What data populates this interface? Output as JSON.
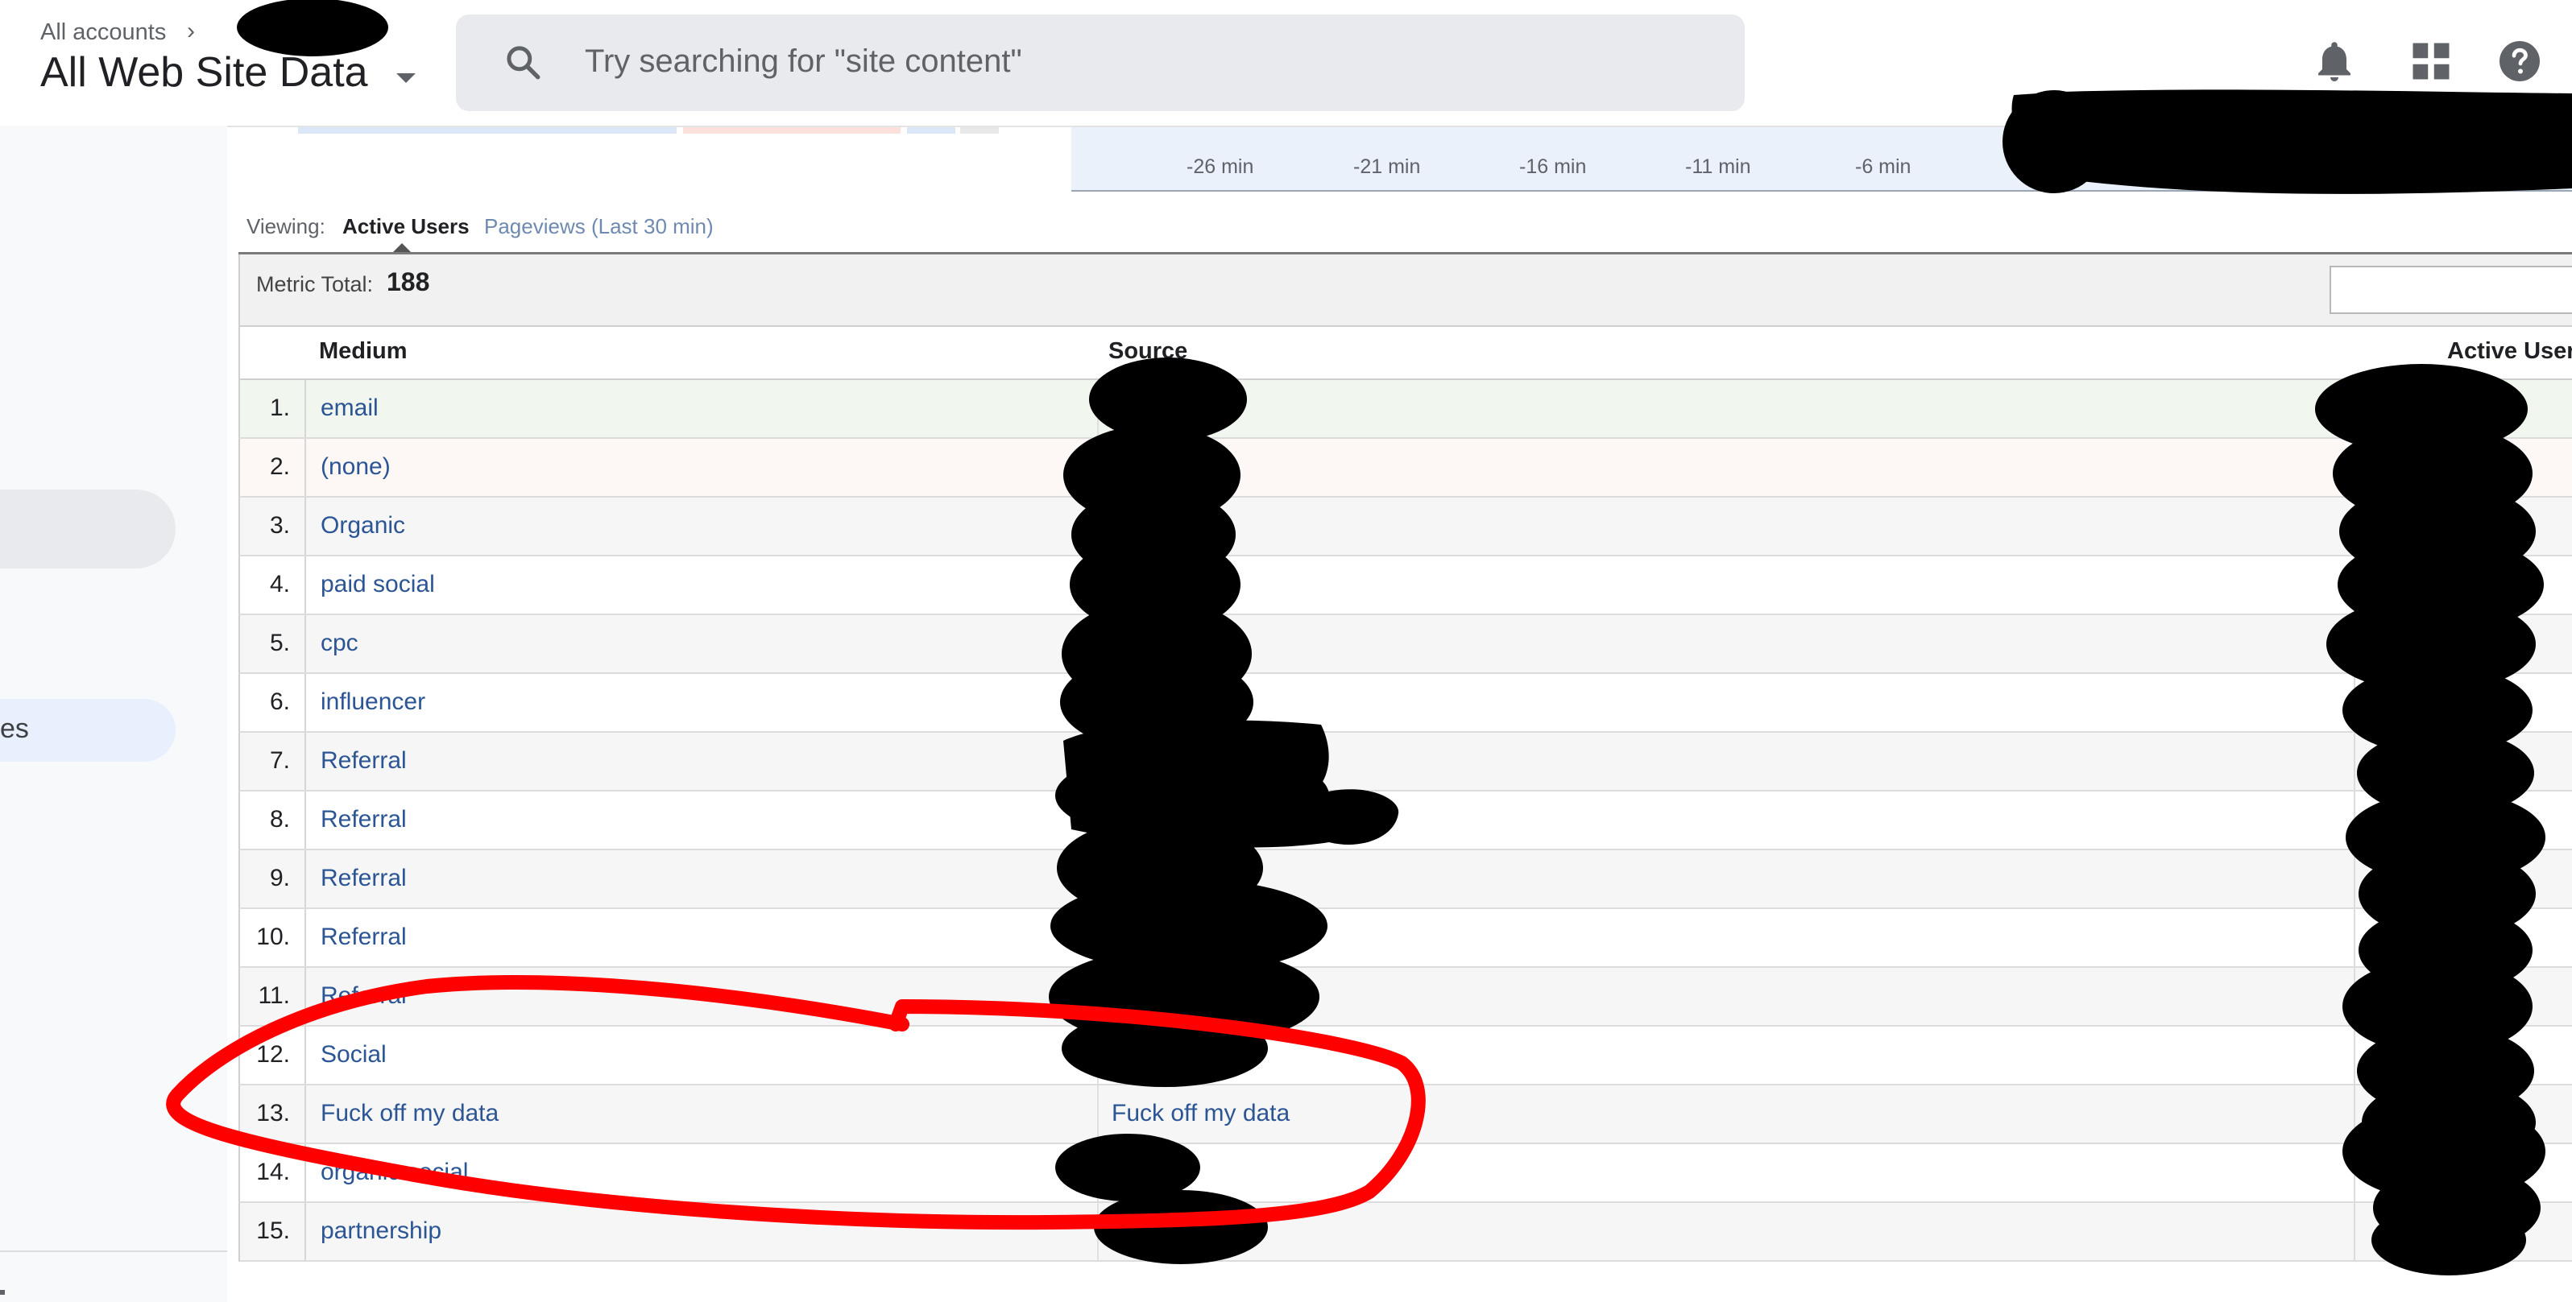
{
  "header": {
    "account_breadcrumb": "All accounts",
    "breadcrumb_chevron": "›",
    "property_name": "All Web Site Data",
    "search_placeholder": "Try searching for \"site content\"",
    "icons": [
      "search-icon",
      "notifications-icon",
      "apps-grid-icon",
      "help-icon"
    ]
  },
  "sidebar": {
    "selected_item_fragment": "es"
  },
  "timeline": {
    "ticks": [
      "-26 min",
      "-21 min",
      "-16 min",
      "-11 min",
      "-6 min"
    ]
  },
  "viewing": {
    "label": "Viewing:",
    "active_tab": "Active Users",
    "other_tab": "Pageviews (Last 30 min)"
  },
  "metric": {
    "label": "Metric Total:",
    "value": "188"
  },
  "table": {
    "columns": [
      "Medium",
      "Source",
      "Active Users"
    ],
    "rows": [
      {
        "index": "1.",
        "medium": "email",
        "source": ""
      },
      {
        "index": "2.",
        "medium": "(none)",
        "source": ""
      },
      {
        "index": "3.",
        "medium": "Organic",
        "source": ""
      },
      {
        "index": "4.",
        "medium": "paid social",
        "source": ""
      },
      {
        "index": "5.",
        "medium": "cpc",
        "source": ""
      },
      {
        "index": "6.",
        "medium": "influencer",
        "source": ""
      },
      {
        "index": "7.",
        "medium": "Referral",
        "source": ""
      },
      {
        "index": "8.",
        "medium": "Referral",
        "source": ""
      },
      {
        "index": "9.",
        "medium": "Referral",
        "source": ""
      },
      {
        "index": "10.",
        "medium": "Referral",
        "source": ""
      },
      {
        "index": "11.",
        "medium": "Referral",
        "source": ""
      },
      {
        "index": "12.",
        "medium": "Social",
        "source": ""
      },
      {
        "index": "13.",
        "medium": "Fuck off my data",
        "source": "Fuck off my data"
      },
      {
        "index": "14.",
        "medium": "organic social",
        "source": ""
      },
      {
        "index": "15.",
        "medium": "partnership",
        "source": ""
      }
    ]
  },
  "colors": {
    "link": "#2b5594",
    "redaction": "#000000",
    "annotation": "#ff0000",
    "timeline_bg": "#eaf1fa"
  }
}
